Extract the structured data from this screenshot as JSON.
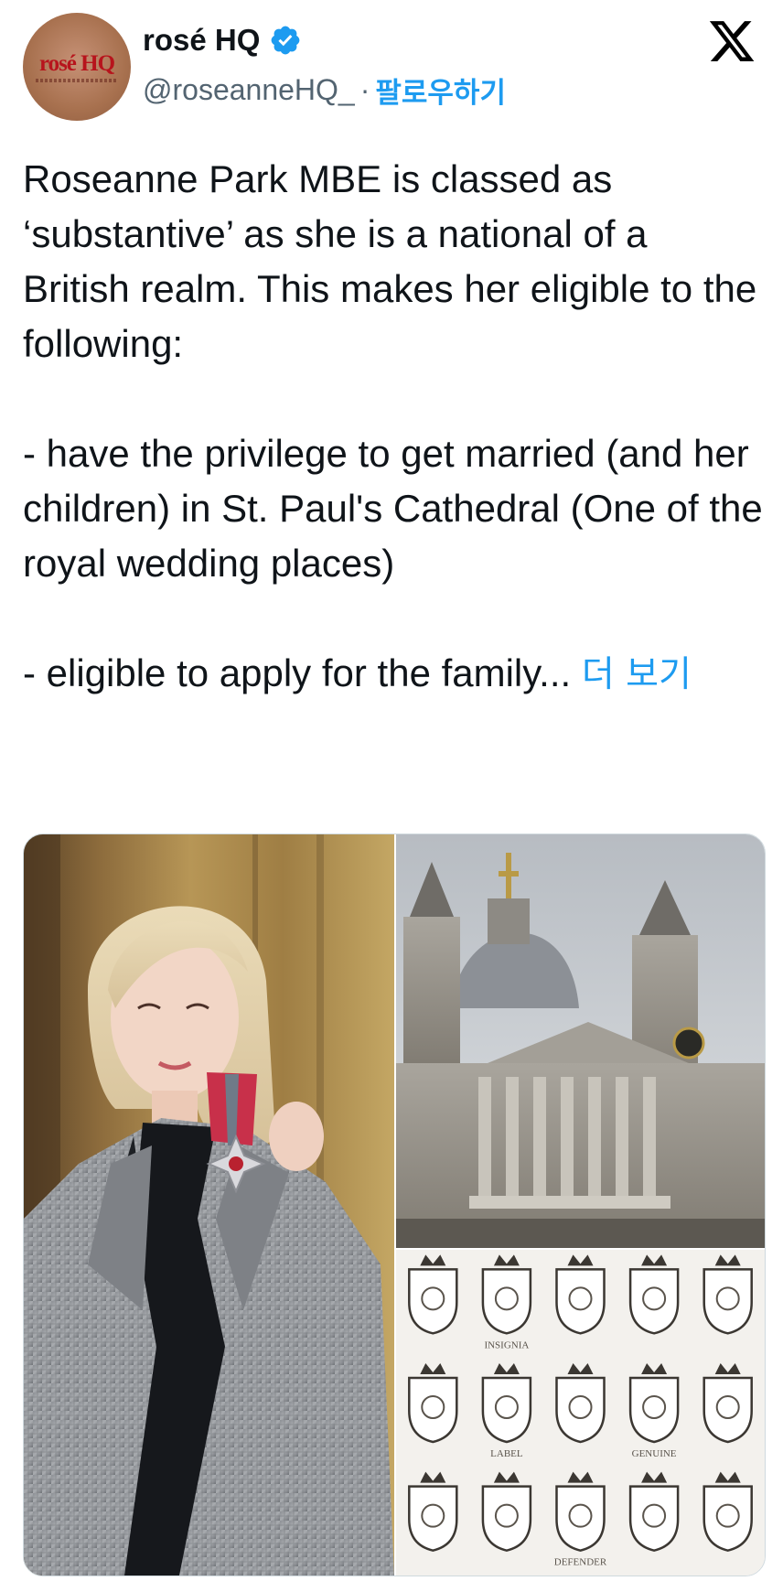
{
  "author": {
    "display_name": "rosé HQ",
    "handle": "@roseanneHQ_",
    "separator": "·",
    "follow_label": "팔로우하기",
    "avatar_logo_text": "rosé HQ",
    "verified_color": "#1d9bf0"
  },
  "platform": {
    "logo_icon": "x-logo-icon"
  },
  "tweet": {
    "paragraphs": [
      "Roseanne Park MBE is classed as ‘substantive’ as she is a national of a British realm. This makes her eligible to the following:",
      "- have the privilege to get married (and her children) in St. Paul's Cathedral (One of the royal wedding places)"
    ],
    "truncated_line": "- eligible to apply for the family... ",
    "show_more_label": "더 보기"
  },
  "media": {
    "photos": [
      {
        "subject": "woman-holding-mbe-medal-photo"
      },
      {
        "subject": "st-pauls-cathedral-photo"
      },
      {
        "subject": "heraldic-emblems-collage"
      }
    ],
    "emblem_labels": [
      "INSIGNIA",
      "LABEL",
      "GENUINE",
      "DEFENDER"
    ]
  },
  "colors": {
    "text": "#0f1419",
    "secondary": "#536471",
    "link": "#1d9bf0",
    "media_border": "#cfd9de"
  }
}
